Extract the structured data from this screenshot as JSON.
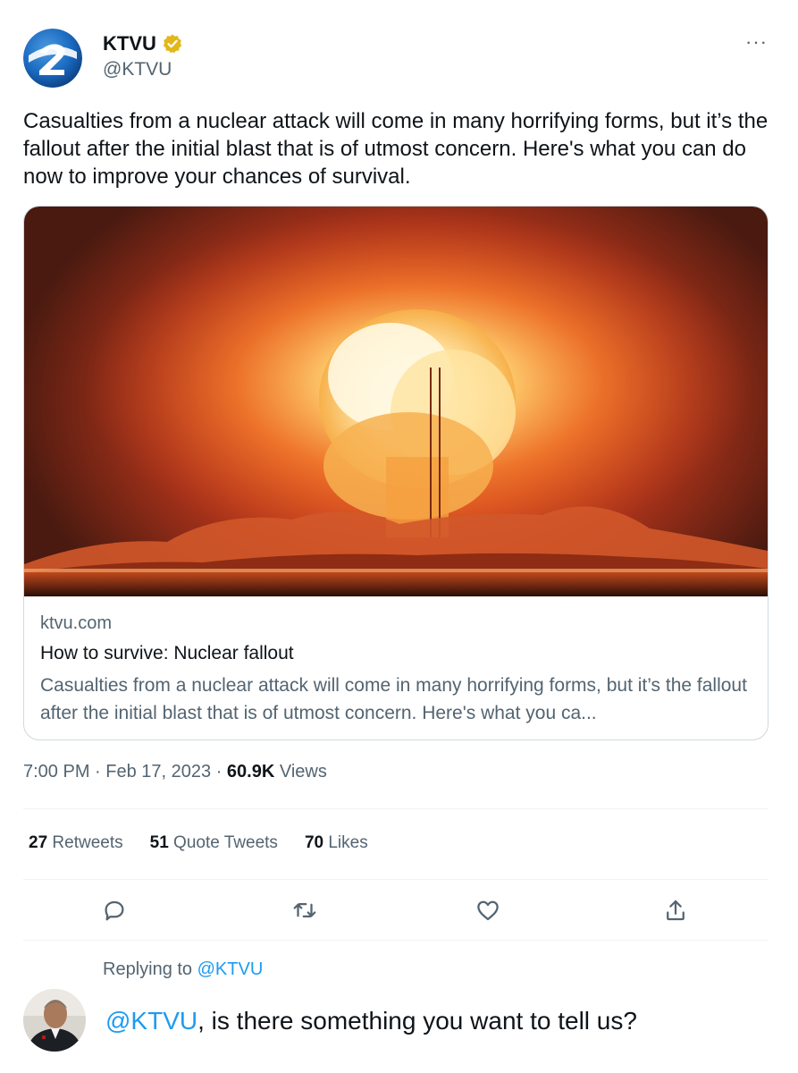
{
  "author": {
    "name": "KTVU",
    "handle": "@KTVU",
    "verified_color": "#e2b719",
    "avatar_icon": "ktvu-2-logo",
    "brand_color": "#1a6fc2"
  },
  "more_icon_label": "···",
  "tweet_text": "Casualties from a nuclear attack will come in many horrifying forms, but it’s the fallout after the initial blast that is of utmost concern. Here's what you can do now to improve your chances of survival.",
  "card": {
    "image_icon": "nuclear-explosion-image",
    "domain": "ktvu.com",
    "title": "How to survive: Nuclear fallout",
    "description": "Casualties from a nuclear attack will come in many horrifying forms, but it’s the fallout after the initial blast that is of utmost concern. Here's what you ca..."
  },
  "meta": {
    "time": "7:00 PM",
    "sep1": " · ",
    "date": "Feb 17, 2023",
    "sep2": " · ",
    "views_count": "60.9K",
    "views_label": " Views"
  },
  "stats": {
    "retweets_count": "27",
    "retweets_label": " Retweets",
    "quotes_count": "51",
    "quotes_label": " Quote Tweets",
    "likes_count": "70",
    "likes_label": " Likes"
  },
  "actions": {
    "reply_icon": "reply-icon",
    "retweet_icon": "retweet-icon",
    "like_icon": "heart-icon",
    "share_icon": "share-icon"
  },
  "reply": {
    "replying_label": "Replying to ",
    "replying_mention": "@KTVU",
    "text_mention": "@KTVU",
    "text_rest": ", is there something you want to tell us?"
  },
  "colors": {
    "accent": "#1d9bf0",
    "secondary_text": "#536471",
    "primary_text": "#0f1419",
    "divider": "#eff3f4"
  }
}
